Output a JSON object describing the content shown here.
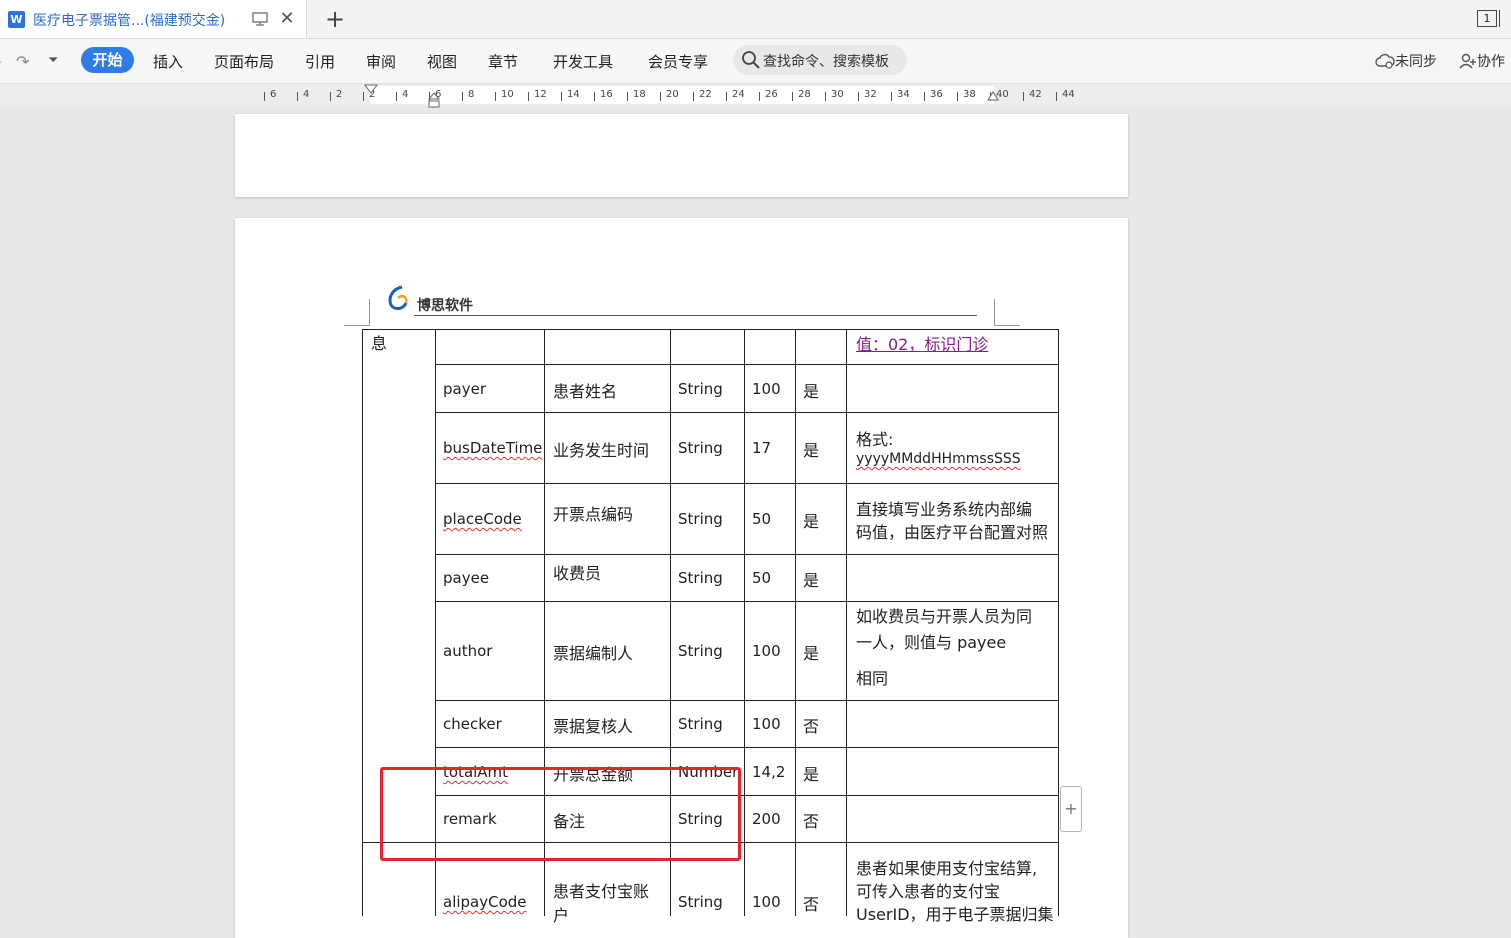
{
  "tabbar": {
    "app_logo": "W",
    "doc_title": "医疗电子票据管...(福建预交金)",
    "new_tab": "+",
    "window_count": "1"
  },
  "ribbon": {
    "menus": [
      "插入",
      "页面布局",
      "引用",
      "审阅",
      "视图",
      "章节",
      "开发工具",
      "会员专享"
    ],
    "active_menu": "开始",
    "search_placeholder": "查找命令、搜索模板",
    "sync_label": "未同步",
    "collab_label": "协作"
  },
  "ruler": {
    "labels": [
      "6",
      "4",
      "2",
      "2",
      "4",
      "6",
      "8",
      "10",
      "12",
      "14",
      "16",
      "18",
      "20",
      "22",
      "24",
      "26",
      "28",
      "30",
      "32",
      "34",
      "36",
      "38",
      "40",
      "42",
      "44"
    ]
  },
  "document": {
    "header_logo_text": "博思软件",
    "section_fragment": "息",
    "top_row_note": "值：02，标识门诊",
    "rows": [
      {
        "field": "payer",
        "name": "患者姓名",
        "type": "String",
        "length": "100",
        "required": "是",
        "note": ""
      },
      {
        "field": "busDateTime",
        "name": "业务发生时间",
        "type": "String",
        "length": "17",
        "required": "是",
        "note_line1": "格式:",
        "note_line2": "yyyyMMddHHmmssSSS"
      },
      {
        "field": "placeCode",
        "name": "开票点编码",
        "type": "String",
        "length": "50",
        "required": "是",
        "note_line1": "直接填写业务系统内部编",
        "note_line2": "码值，由医疗平台配置对照"
      },
      {
        "field": "payee",
        "name": "收费员",
        "type": "String",
        "length": "50",
        "required": "是",
        "note": ""
      },
      {
        "field": "author",
        "name": "票据编制人",
        "type": "String",
        "length": "100",
        "required": "是",
        "note_line1": "如收费员与开票人员为同",
        "note_line2": "一人，则值与 payee",
        "note_line3": "相同"
      },
      {
        "field": "checker",
        "name": "票据复核人",
        "type": "String",
        "length": "100",
        "required": "否",
        "note": ""
      },
      {
        "field": "totalAmt",
        "name": "开票总金额",
        "type": "Number",
        "length": "14,2",
        "required": "是",
        "note": ""
      },
      {
        "field": "remark",
        "name": "备注",
        "type": "String",
        "length": "200",
        "required": "否",
        "note": ""
      },
      {
        "field": "alipayCode",
        "name_line1": "患者支付宝账",
        "name_line2": "户",
        "type": "String",
        "length": "100",
        "required": "否",
        "note_line1": "患者如果使用支付宝结算,",
        "note_line2": "可传入患者的支付宝",
        "note_line3": "UserID，用于电子票据归集"
      }
    ],
    "add_row_button": "+"
  },
  "colors": {
    "accent": "#2f7ce6",
    "highlight": "#e8232c",
    "link": "#8a1a8e"
  }
}
